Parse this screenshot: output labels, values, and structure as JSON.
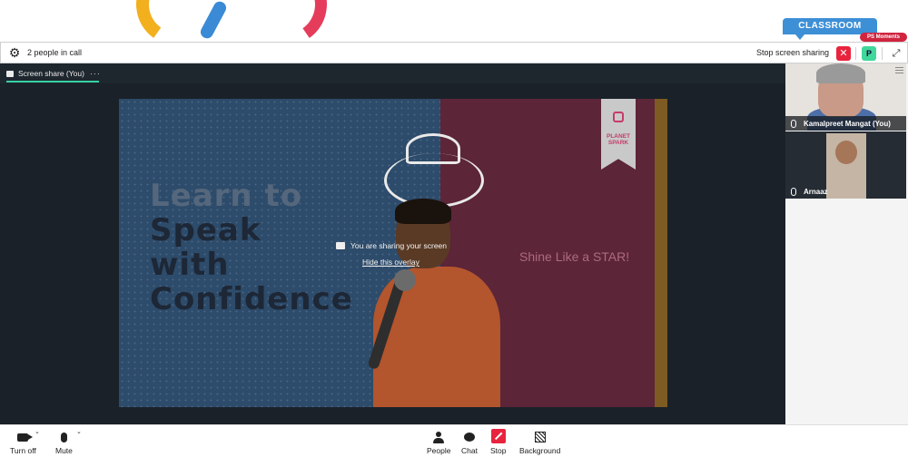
{
  "top": {
    "classroom_label": "CLASSROOM",
    "moments_label": "PS Moments"
  },
  "header": {
    "people_count": "2 people in call",
    "stop_sharing_label": "Stop screen sharing",
    "close_symbol": "✕",
    "participant_initial": "P",
    "expand_symbol": "⤢"
  },
  "stage": {
    "tab_label": "Screen share (You)",
    "tab_more": "···",
    "overlay_message": "You are sharing your screen",
    "hide_overlay": "Hide this overlay"
  },
  "slide": {
    "headline_line1": "Learn to",
    "headline_line2": "Speak",
    "headline_line3": "with",
    "headline_line4": "Confidence",
    "tagline": "Shine Like a STAR!",
    "logo_line1": "PLANET",
    "logo_line2": "SPARK"
  },
  "participants": [
    {
      "name": "Kamalpreet Mangat (You)"
    },
    {
      "name": "Arnaaz"
    }
  ],
  "controls": {
    "turn_off": "Turn off",
    "mute": "Mute",
    "people": "People",
    "chat": "Chat",
    "stop": "Stop",
    "background": "Background",
    "caret": "⌄"
  },
  "colors": {
    "accent_green": "#36d2a2",
    "danger_red": "#e8233e",
    "classroom_blue": "#3d8fd6",
    "slide_blue": "#2d4b6a",
    "slide_maroon": "#5c2538"
  },
  "icons": [
    "gear-icon",
    "close-icon",
    "expand-icon",
    "screen-share-icon",
    "upload-icon",
    "microphone-icon",
    "camera-icon",
    "people-icon",
    "chat-icon",
    "stop-share-icon",
    "background-icon"
  ]
}
